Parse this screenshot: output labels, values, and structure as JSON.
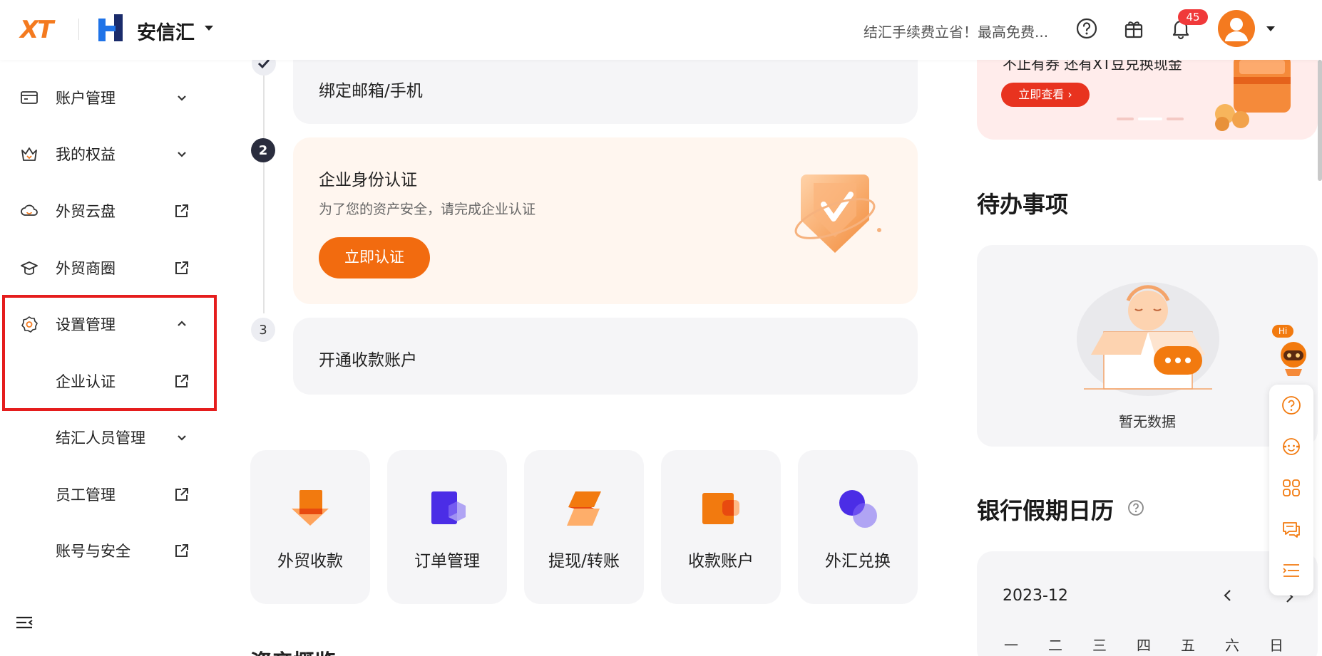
{
  "header": {
    "logo_text": "XT",
    "brand_name": "安信汇",
    "promo_text": "结汇手续费立省！最高免费...",
    "notification_count": "45"
  },
  "sidebar": {
    "items": [
      {
        "label": "账户管理",
        "icon": "card-icon",
        "arrow": "chevron-down"
      },
      {
        "label": "我的权益",
        "icon": "crown-icon",
        "arrow": "chevron-down"
      },
      {
        "label": "外贸云盘",
        "icon": "cloud-icon",
        "arrow": "external-link"
      },
      {
        "label": "外贸商圈",
        "icon": "graduation-cap-icon",
        "arrow": "external-link"
      },
      {
        "label": "设置管理",
        "icon": "gear-icon",
        "arrow": "chevron-up"
      },
      {
        "label": "企业认证",
        "arrow": "external-link"
      },
      {
        "label": "结汇人员管理",
        "arrow": "chevron-down"
      },
      {
        "label": "员工管理",
        "arrow": "external-link"
      },
      {
        "label": "账号与安全",
        "arrow": "external-link"
      }
    ]
  },
  "steps": {
    "step1_title": "绑定邮箱/手机",
    "step2_num": "2",
    "step2_title": "企业身份认证",
    "step2_subtitle": "为了您的资产安全，请完成企业认证",
    "step2_button": "立即认证",
    "step3_num": "3",
    "step3_title": "开通收款账户"
  },
  "quick_actions": [
    {
      "label": "外贸收款",
      "icon": "receive-payment-icon"
    },
    {
      "label": "订单管理",
      "icon": "order-icon"
    },
    {
      "label": "提现/转账",
      "icon": "transfer-icon"
    },
    {
      "label": "收款账户",
      "icon": "wallet-icon"
    },
    {
      "label": "外汇兑换",
      "icon": "exchange-icon"
    }
  ],
  "cut_section_title": "资产概览",
  "banner": {
    "text": "不止有券 还有XT豆兑换现金",
    "button": "立即查看 ›"
  },
  "todo": {
    "title": "待办事项",
    "empty": "暂无数据"
  },
  "calendar": {
    "title": "银行假期日历",
    "month": "2023-12",
    "weekdays": [
      "一",
      "二",
      "三",
      "四",
      "五",
      "六",
      "日"
    ]
  },
  "float_bot_badge": "Hi",
  "colors": {
    "accent": "#f26b0f",
    "highlight": "#e51d1d",
    "badge": "#f0393a"
  }
}
